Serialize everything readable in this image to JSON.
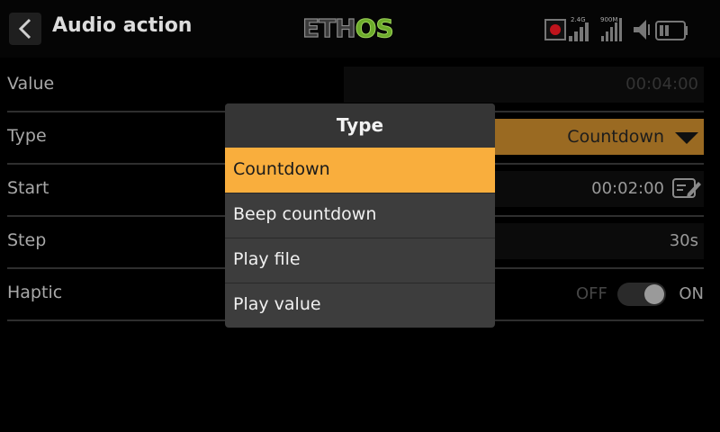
{
  "header": {
    "title": "Audio action",
    "logo_text": [
      "ETH",
      "OS"
    ],
    "status": {
      "rx_label": "2.4G",
      "rx2_label": "900M"
    }
  },
  "form": {
    "value": {
      "label": "Value",
      "value": "00:04:00"
    },
    "type": {
      "label": "Type",
      "value": "Countdown"
    },
    "start": {
      "label": "Start",
      "value": "00:02:00"
    },
    "step": {
      "label": "Step",
      "value": "30s"
    },
    "haptic": {
      "label": "Haptic",
      "off_label": "OFF",
      "on_label": "ON",
      "state": true
    }
  },
  "popup": {
    "title": "Type",
    "options": [
      "Countdown",
      "Beep countdown",
      "Play file",
      "Play value"
    ],
    "selected_index": 0
  },
  "colors": {
    "accent": "#f9ae3d",
    "logo_green": "#6cab2a",
    "record": "#c0141c"
  }
}
